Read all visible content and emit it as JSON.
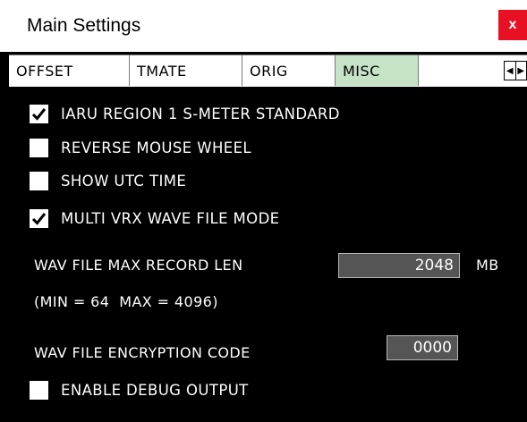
{
  "window": {
    "title": "Main Settings",
    "close_label": "x"
  },
  "tabs": [
    {
      "label": "OFFSET",
      "active": false
    },
    {
      "label": "TMATE",
      "active": false
    },
    {
      "label": "ORIG",
      "active": false
    },
    {
      "label": "MISC",
      "active": true
    }
  ],
  "tab_scroll": {
    "left_icon": "◀",
    "right_icon": "▶"
  },
  "options": [
    {
      "label": "IARU REGION 1 S-METER STANDARD",
      "checked": true
    },
    {
      "label": "REVERSE MOUSE WHEEL",
      "checked": false
    },
    {
      "label": "SHOW UTC TIME",
      "checked": false
    },
    {
      "label": "MULTI VRX WAVE FILE MODE",
      "checked": true
    }
  ],
  "wav_max": {
    "label": "WAV FILE MAX RECORD LEN",
    "value": "2048",
    "unit": "MB",
    "range_note": "(MIN = 64  MAX = 4096)"
  },
  "encryption": {
    "label": "WAV FILE ENCRYPTION CODE",
    "value": "0000"
  },
  "debug": {
    "label": "ENABLE DEBUG OUTPUT",
    "checked": false
  },
  "colors": {
    "panel_bg": "#000000",
    "active_tab": "#c6e3c8",
    "close_bg": "#e81123",
    "field_bg": "#555555"
  }
}
